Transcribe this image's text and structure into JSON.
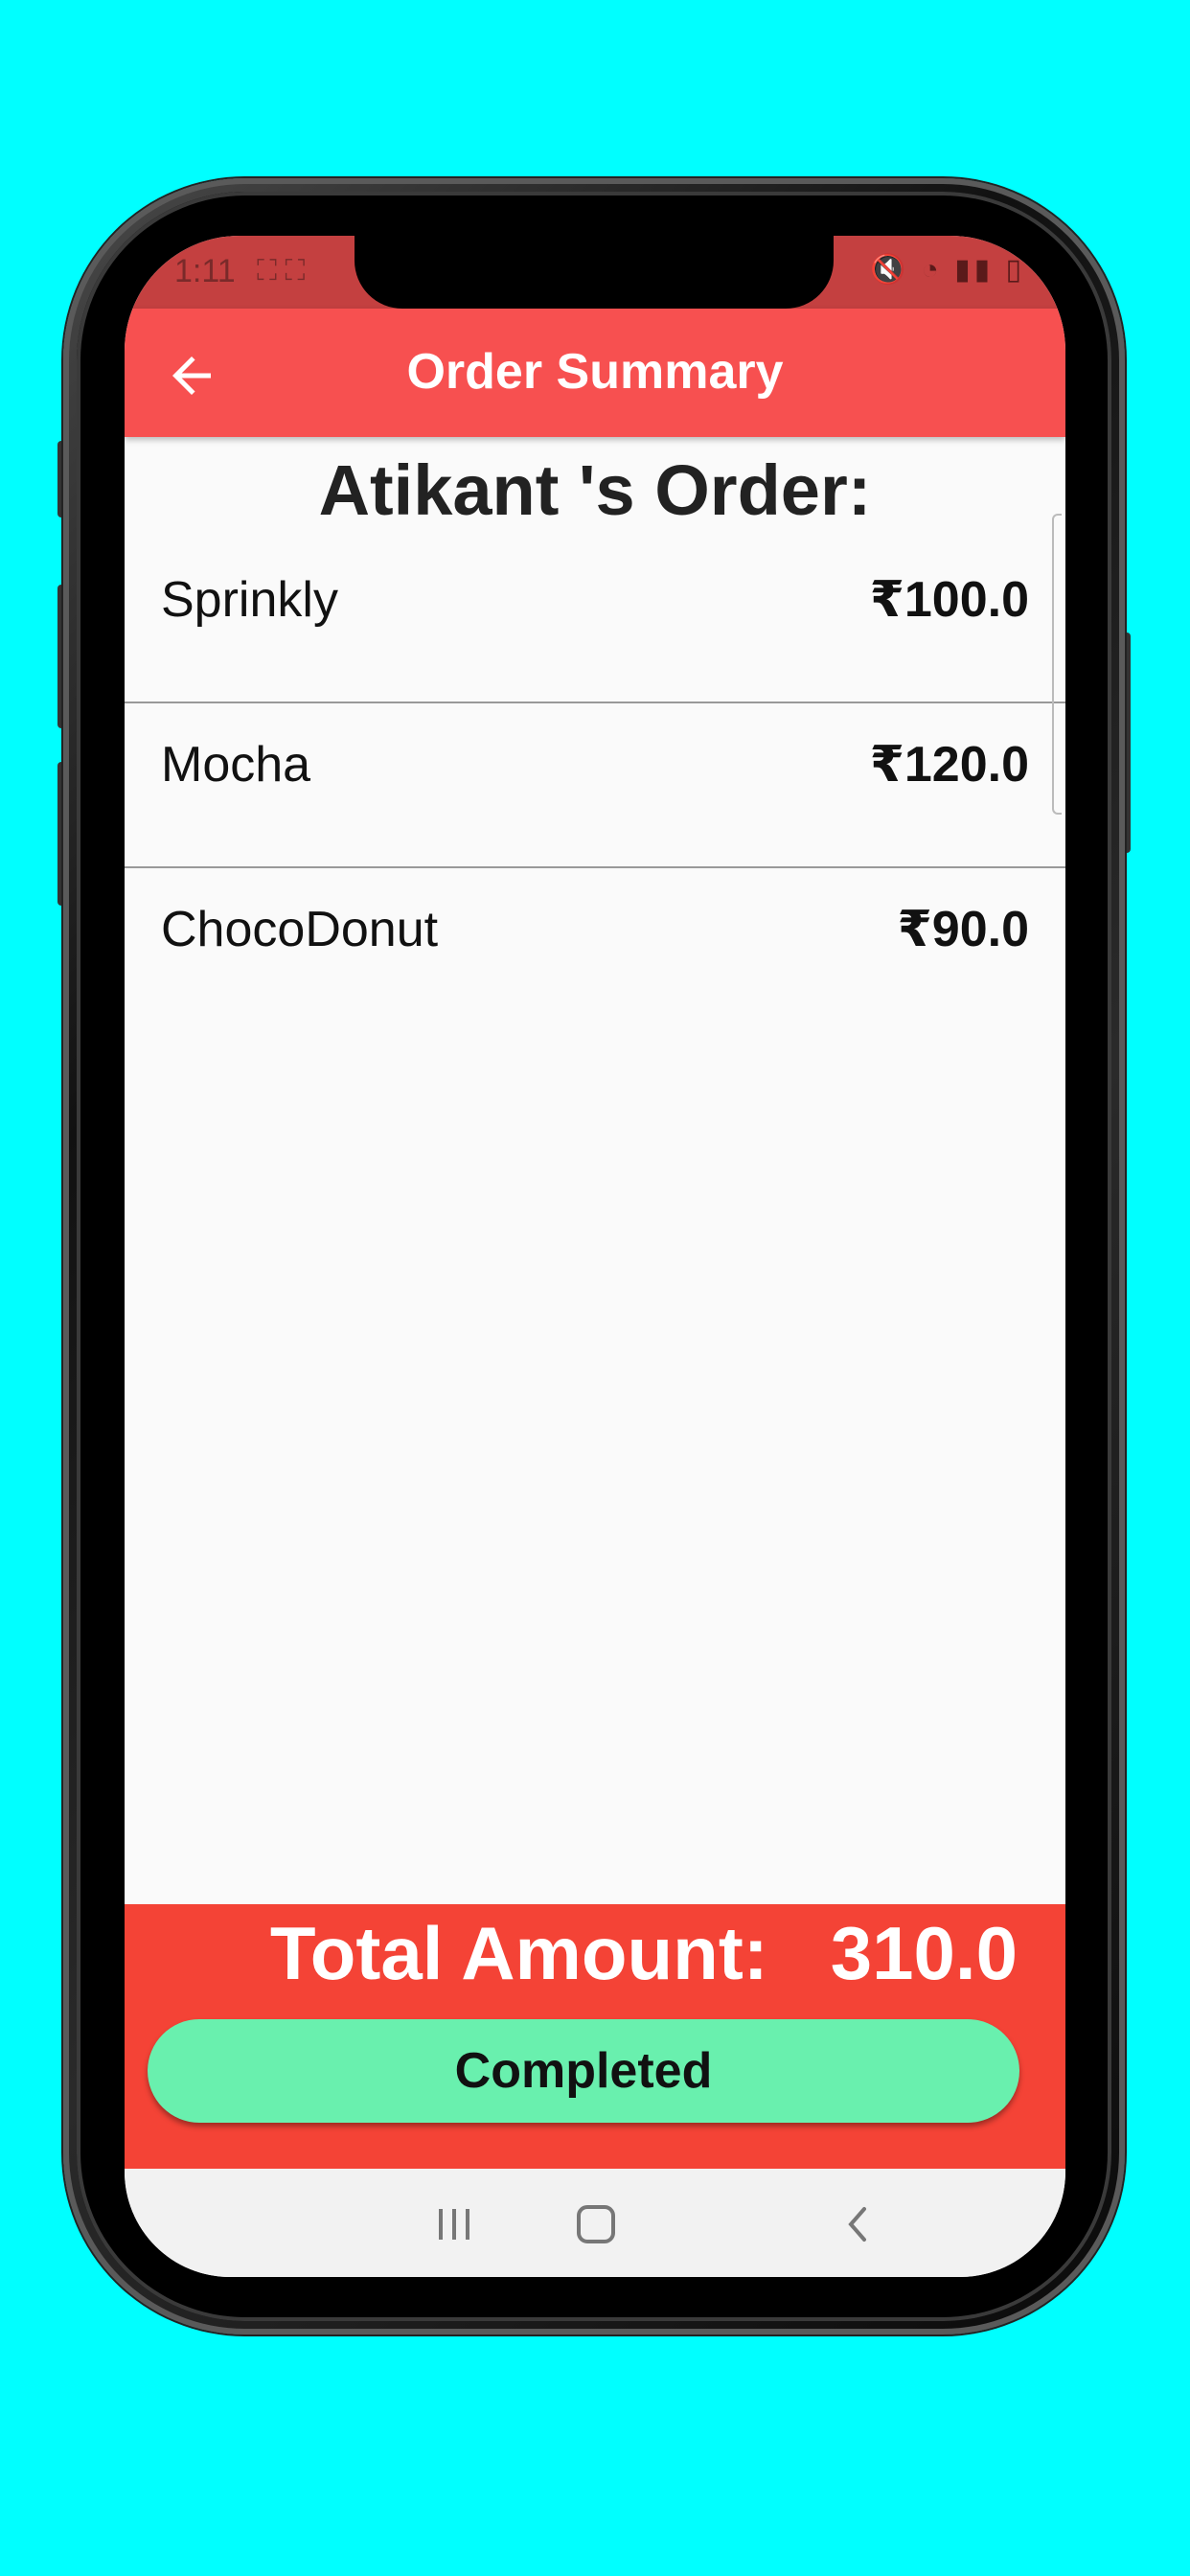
{
  "status_bar": {
    "time": "1:11",
    "icons": [
      "screenshot-icon",
      "screenshot-icon",
      "mute-icon",
      "wifi-icon",
      "wifi-call-icon",
      "signal-icon",
      "battery-charging-icon"
    ]
  },
  "app_bar": {
    "title": "Order Summary",
    "back_icon": "arrow-back-icon"
  },
  "order": {
    "heading": "Atikant 's Order:",
    "items": [
      {
        "name": "Sprinkly",
        "price": "₹100.0"
      },
      {
        "name": "Mocha",
        "price": "₹120.0"
      },
      {
        "name": "ChocoDonut",
        "price": "₹90.0"
      }
    ]
  },
  "footer": {
    "total_label": "Total Amount:",
    "total_value": "310.0",
    "button_label": "Completed"
  },
  "colors": {
    "app_bar": "#F75050",
    "footer": "#F44336",
    "button": "#69F0AE",
    "background": "#00FFFF"
  },
  "nav_bar": {
    "icons": [
      "recent-apps-icon",
      "home-icon",
      "back-icon"
    ]
  }
}
